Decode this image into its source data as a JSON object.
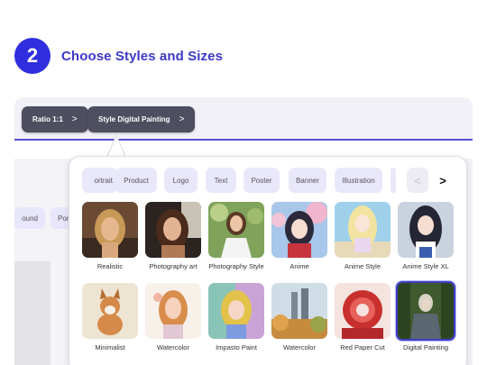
{
  "step": {
    "number": "2",
    "title": "Choose Styles and Sizes"
  },
  "toolbar": {
    "ratio_label": "Ratio 1:1",
    "style_label": "Style Digital Painting",
    "chevron": ">"
  },
  "background_chips": [
    "ound",
    "Por"
  ],
  "style_popup": {
    "categories": [
      "ortrait",
      "Product",
      "Logo",
      "Text",
      "Poster",
      "Banner",
      "Illustration"
    ],
    "prev_icon": "<",
    "next_icon": ">",
    "styles_row1": [
      "Realistic",
      "Photography art",
      "Photography Style",
      "Anime",
      "Anime Style",
      "Anime Style XL"
    ],
    "styles_row2": [
      "Minimalist",
      "Watercolor",
      "Impasto Paint",
      "Watercolor",
      "Red Paper Cut",
      "Digital Painting"
    ],
    "selected_style": "Digital Painting"
  },
  "colors": {
    "accent": "#2f2ee0",
    "title": "#3d39c9",
    "chip_dark": "#4e4e61",
    "chip_light": "#e9e8fb"
  }
}
